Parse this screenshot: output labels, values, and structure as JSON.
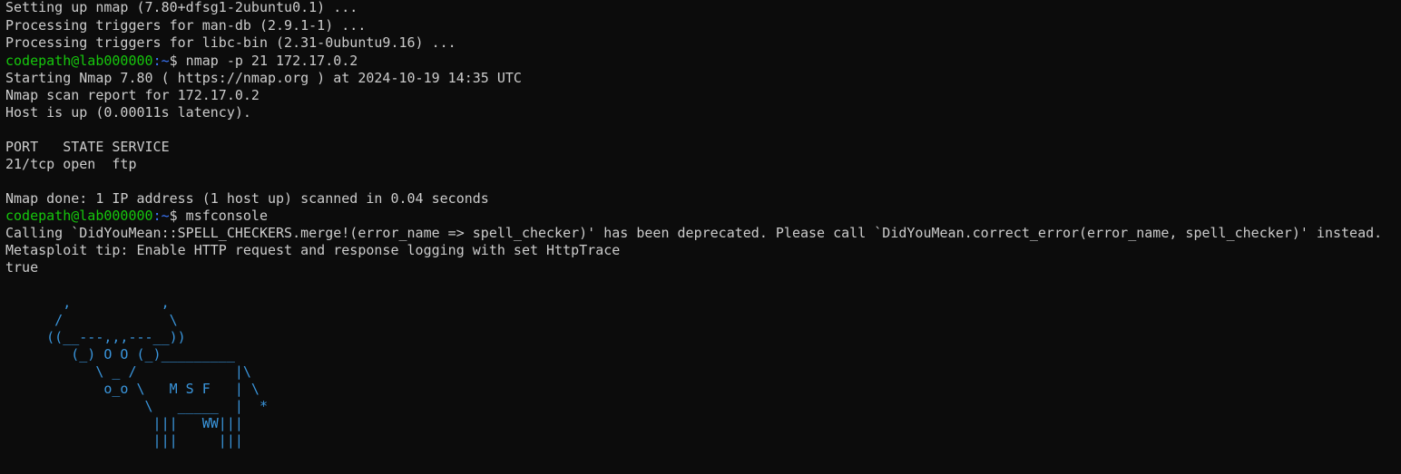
{
  "colors": {
    "background": "#0c0c0c",
    "text": "#cccccc",
    "prompt_user": "#16c60c",
    "prompt_path": "#3b78ff",
    "ascii_art": "#3a96dd"
  },
  "terminal": {
    "output_lines": [
      "Setting up nmap (7.80+dfsg1-2ubuntu0.1) ...",
      "Processing triggers for man-db (2.9.1-1) ...",
      "Processing triggers for libc-bin (2.31-0ubuntu9.16) ..."
    ],
    "prompt1": {
      "user_host": "codepath@lab000000",
      "path": ":~",
      "sign": "$",
      "command": " nmap -p 21 172.17.0.2"
    },
    "nmap_output": [
      "Starting Nmap 7.80 ( https://nmap.org ) at 2024-10-19 14:35 UTC",
      "Nmap scan report for 172.17.0.2",
      "Host is up (0.00011s latency).",
      "",
      "PORT   STATE SERVICE",
      "21/tcp open  ftp",
      "",
      "Nmap done: 1 IP address (1 host up) scanned in 0.04 seconds"
    ],
    "prompt2": {
      "user_host": "codepath@lab000000",
      "path": ":~",
      "sign": "$",
      "command": " msfconsole"
    },
    "msf_output": [
      "Calling `DidYouMean::SPELL_CHECKERS.merge!(error_name => spell_checker)' has been deprecated. Please call `DidYouMean.correct_error(error_name, spell_checker)' instead.",
      "Metasploit tip: Enable HTTP request and response logging with set HttpTrace",
      "true"
    ],
    "ascii_art": [
      "       ,           ,",
      "      /             \\",
      "     ((__---,,,---__))",
      "        (_) O O (_)_________",
      "           \\ _ /            |\\",
      "            o_o \\   M S F   | \\",
      "                 \\   _____  |  *",
      "                  |||   WW|||",
      "                  |||     |||"
    ]
  }
}
